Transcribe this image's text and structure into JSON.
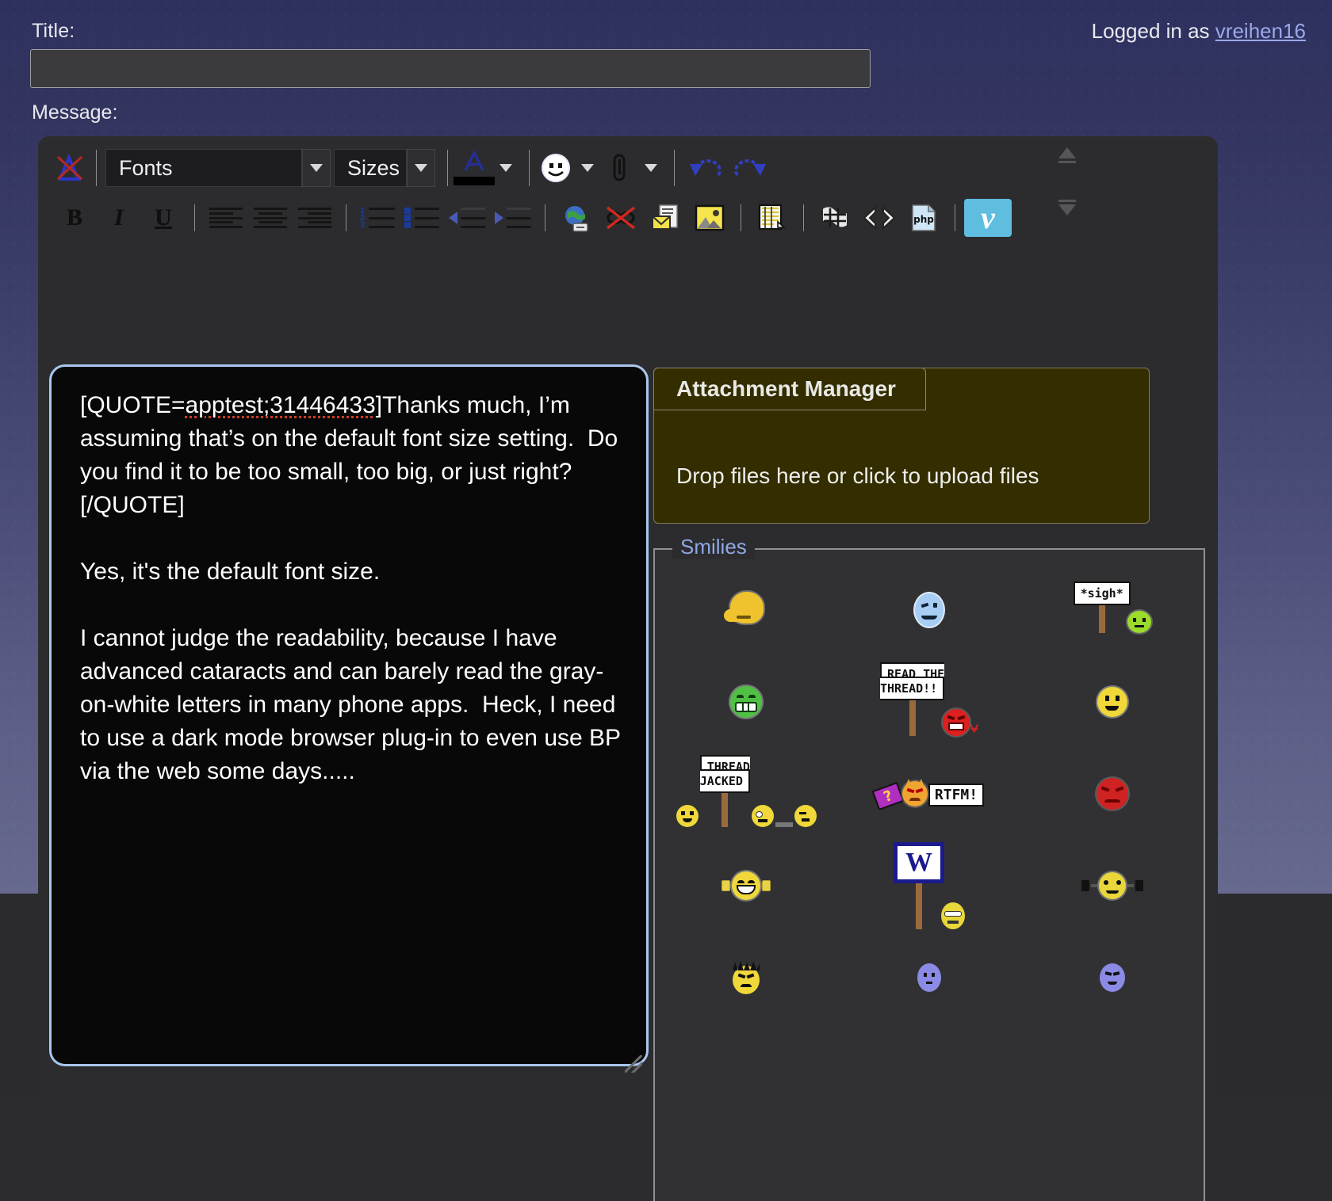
{
  "header": {
    "title_label": "Title:",
    "message_label": "Message:",
    "login_prefix": "Logged in as ",
    "username": "vreihen16",
    "title_value": "",
    "title_placeholder": ""
  },
  "toolbar": {
    "row1": [
      {
        "name": "toggle-wysiwyg-icon",
        "label": "A"
      },
      {
        "name": "font-family-select",
        "label": "Fonts"
      },
      {
        "name": "font-size-select",
        "label": "Sizes"
      },
      {
        "name": "font-color-icon",
        "label": "A"
      },
      {
        "name": "smilie-picker-icon",
        "label": "smiley"
      },
      {
        "name": "attachment-icon",
        "label": "paperclip"
      },
      {
        "name": "undo-icon",
        "label": "undo"
      },
      {
        "name": "redo-icon",
        "label": "redo"
      }
    ],
    "row2": [
      {
        "name": "bold-button",
        "label": "B"
      },
      {
        "name": "italic-button",
        "label": "I"
      },
      {
        "name": "underline-button",
        "label": "U"
      },
      {
        "name": "align-left-button",
        "label": "align left"
      },
      {
        "name": "align-center-button",
        "label": "align center"
      },
      {
        "name": "align-right-button",
        "label": "align right"
      },
      {
        "name": "ordered-list-button",
        "label": "numbered list"
      },
      {
        "name": "unordered-list-button",
        "label": "bulleted list"
      },
      {
        "name": "outdent-button",
        "label": "outdent"
      },
      {
        "name": "indent-button",
        "label": "indent"
      },
      {
        "name": "insert-link-button",
        "label": "insert link"
      },
      {
        "name": "remove-link-button",
        "label": "remove link"
      },
      {
        "name": "insert-email-button",
        "label": "insert email"
      },
      {
        "name": "insert-image-button",
        "label": "insert image"
      },
      {
        "name": "wrap-quote-button",
        "label": "wrap quote"
      },
      {
        "name": "insert-hash-button",
        "label": "#"
      },
      {
        "name": "insert-code-button",
        "label": "<>"
      },
      {
        "name": "insert-php-button",
        "label": "php"
      },
      {
        "name": "insert-video-button",
        "label": "v"
      }
    ],
    "fonts_label": "Fonts",
    "sizes_label": "Sizes"
  },
  "message": {
    "quote_open": "[QUOTE=",
    "quote_ref": "apptest;31446433",
    "quote_close": "]",
    "part1": "Thanks much, I’m assuming that’s on the default font size setting.  Do you find it to be too small, too big, or just right?[/QUOTE]",
    "part2": "Yes, it's the default font size.",
    "part3": "I cannot judge the readability, because I have advanced cataracts and can barely read the gray-on-white letters in many phone apps.  Heck, I need to use a dark mode browser plug-in to even use BP via the web some days....."
  },
  "attachment": {
    "title": "Attachment Manager",
    "drop_text": "Drop files here or click to upload files",
    "panel_color": "#332d00"
  },
  "smilies": {
    "legend": "Smilies",
    "legend_color": "#8fa8e6",
    "items": [
      {
        "name": "smilie-facepalm",
        "kind": "facepalm",
        "title": "facepalm"
      },
      {
        "name": "smilie-cool-blue",
        "kind": "coolblue",
        "title": "cool"
      },
      {
        "name": "smilie-sigh-sign",
        "kind": "sign-face",
        "sign": "*sigh*",
        "title": "sigh"
      },
      {
        "name": "smilie-green-grin",
        "kind": "greengrin",
        "title": "green grin"
      },
      {
        "name": "smilie-read-the-thread",
        "kind": "sign-angry",
        "sign": "READ THE\nTHREAD!!",
        "title": "read the thread"
      },
      {
        "name": "smilie-yellow-smile",
        "kind": "plain",
        "title": "smile"
      },
      {
        "name": "smilie-thread-jacked",
        "kind": "threadjacked",
        "sign": "THREAD\nJACKED",
        "title": "thread jacked"
      },
      {
        "name": "smilie-rtfm",
        "kind": "rtfm",
        "sign": "RTFM!",
        "title": "rtfm"
      },
      {
        "name": "smilie-red-stop",
        "kind": "redstop",
        "title": "stop"
      },
      {
        "name": "smilie-clap",
        "kind": "clap",
        "title": "clap"
      },
      {
        "name": "smilie-welcome-sign",
        "kind": "wsign",
        "sign": "W",
        "title": "welcome"
      },
      {
        "name": "smilie-dumbbell",
        "kind": "dumbbell",
        "title": "workout"
      },
      {
        "name": "smilie-angry-hair",
        "kind": "angryhair",
        "title": "angry"
      },
      {
        "name": "smilie-purple-blank",
        "kind": "purple",
        "title": "blank"
      },
      {
        "name": "smilie-purple-confused",
        "kind": "purple2",
        "title": "confused"
      }
    ]
  },
  "colors": {
    "page_top": "#2e3060",
    "page_mid": "#5c5e86",
    "editor_bg": "#2c2c2e",
    "textarea_bg": "#080809",
    "focus_border": "#a8c6ef",
    "link": "#9aa8e8"
  }
}
